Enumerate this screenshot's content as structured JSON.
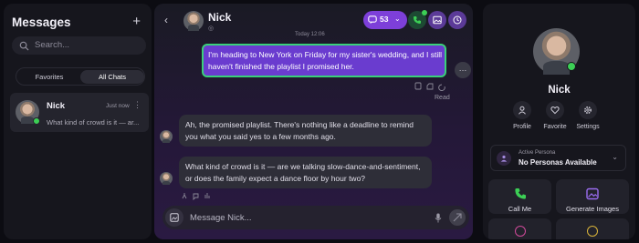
{
  "sidebar": {
    "title": "Messages",
    "new_chat_icon": "plus-icon",
    "search_placeholder": "Search...",
    "tabs": [
      {
        "label": "Favorites",
        "active": false
      },
      {
        "label": "All Chats",
        "active": true
      }
    ],
    "chats": [
      {
        "name": "Nick",
        "time": "Just now",
        "preview": "What kind of crowd is it — ar...",
        "online": true
      }
    ]
  },
  "chat": {
    "contact_name": "Nick",
    "credits": "53",
    "day_label": "Today 12:06",
    "messages": [
      {
        "from": "user",
        "text": "I'm heading to New York on Friday for my sister's wedding, and I still haven't finished the playlist I promised her."
      },
      {
        "from": "bot",
        "text": "Ah, the promised playlist. There's nothing like a deadline to remind you what you said yes to a few months ago."
      },
      {
        "from": "bot",
        "text": "What kind of crowd is it — are we talking slow-dance-and-sentiment, or does the family expect a dance floor by hour two?"
      }
    ],
    "read_label": "Read",
    "input_placeholder": "Message Nick...",
    "accent_color": "#6a3ccf",
    "online_color": "#3ccf55"
  },
  "profile": {
    "name": "Nick",
    "actions": [
      {
        "label": "Profile",
        "icon": "user-icon"
      },
      {
        "label": "Favorite",
        "icon": "heart-icon"
      },
      {
        "label": "Settings",
        "icon": "gear-icon"
      }
    ],
    "persona_label": "Active Persona",
    "persona_value": "No Personas Available",
    "cards": [
      {
        "label": "Call Me",
        "icon": "phone-icon"
      },
      {
        "label": "Generate Images",
        "icon": "image-icon"
      }
    ]
  }
}
